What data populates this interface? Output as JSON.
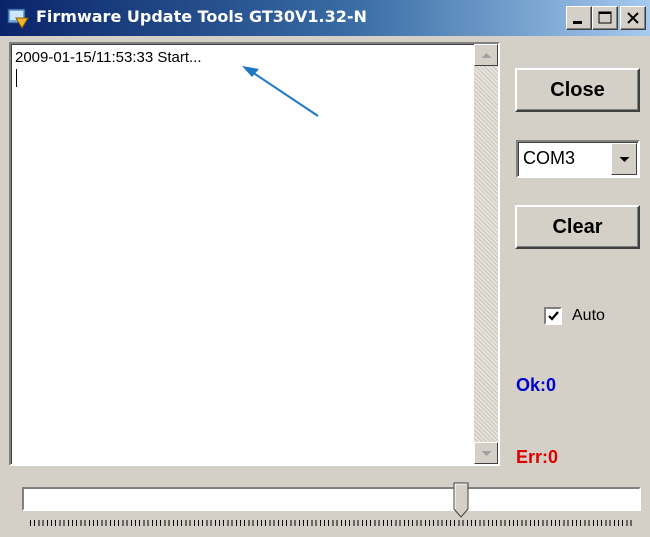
{
  "window": {
    "title": "Firmware Update Tools GT30V1.32-N",
    "icon": "firmware-app-icon",
    "minimize_icon": "minimize-icon",
    "maximize_icon": "maximize-icon",
    "close_icon": "close-icon"
  },
  "log": {
    "lines": [
      "2009-01-15/11:53:33 Start..."
    ]
  },
  "controls": {
    "close_label": "Close",
    "port_selected": "COM3",
    "clear_label": "Clear",
    "auto_label": "Auto",
    "auto_checked": true
  },
  "status": {
    "ok_text": "Ok:0",
    "ok_color": "#0000cc",
    "err_text": "Err:0",
    "err_color": "#dd0000"
  },
  "slider": {
    "position_fraction": 0.71
  },
  "annotation": {
    "arrow_color": "#1f77c4"
  }
}
